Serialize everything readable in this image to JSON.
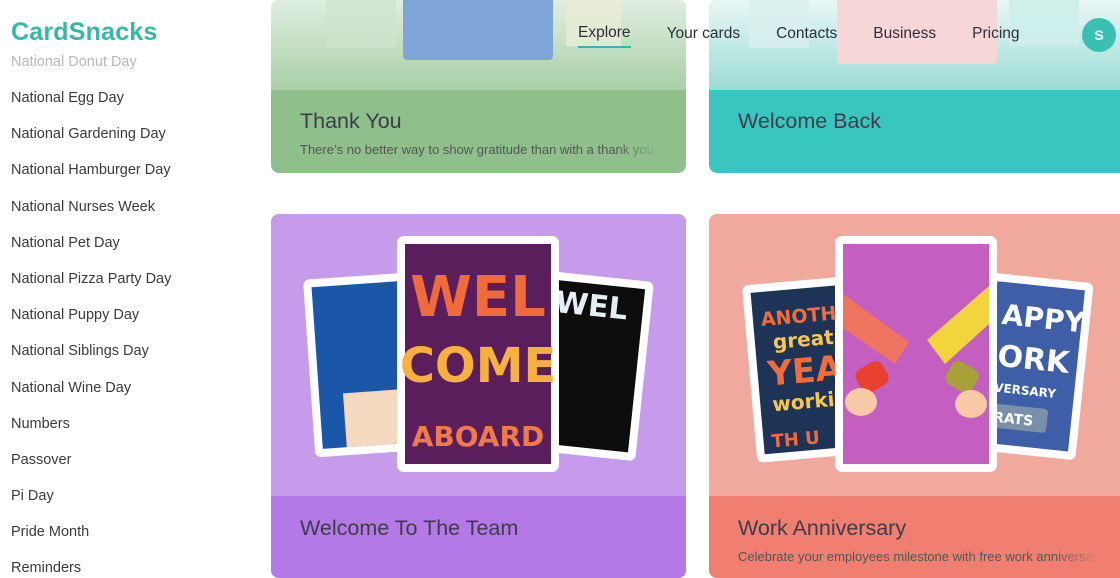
{
  "app": {
    "brand": "CardSnacks"
  },
  "nav": {
    "items": [
      {
        "label": "Explore",
        "active": true
      },
      {
        "label": "Your cards"
      },
      {
        "label": "Contacts"
      },
      {
        "label": "Business"
      },
      {
        "label": "Pricing"
      }
    ],
    "avatar_initial": "S"
  },
  "sidebar": {
    "items": [
      {
        "label": "National Donut Day"
      },
      {
        "label": "National Egg Day"
      },
      {
        "label": "National Gardening Day"
      },
      {
        "label": "National Hamburger Day"
      },
      {
        "label": "National Nurses Week"
      },
      {
        "label": "National Pet Day"
      },
      {
        "label": "National Pizza Party Day"
      },
      {
        "label": "National Puppy Day"
      },
      {
        "label": "National Siblings Day"
      },
      {
        "label": "National Wine Day"
      },
      {
        "label": "Numbers"
      },
      {
        "label": "Passover"
      },
      {
        "label": "Pi Day"
      },
      {
        "label": "Pride Month"
      },
      {
        "label": "Reminders"
      }
    ]
  },
  "cards": [
    {
      "title": "Thank You",
      "description": "There’s no better way to show gratitude than with a thank you card"
    },
    {
      "title": "Welcome Back",
      "description": ""
    },
    {
      "title": "Welcome To The Team",
      "description": "",
      "art_text": [
        "WEL",
        "COME",
        "ABOARD",
        "WEL"
      ]
    },
    {
      "title": "Work Anniversary",
      "description": "Celebrate your employees milestone with free work anniversary cards",
      "art_text": [
        "ANOTH",
        "great",
        "YEA",
        "worki",
        "TH U",
        "APPY",
        "ORK",
        "VERSARY",
        "RATS"
      ]
    }
  ],
  "colors": {
    "brand": "#35b9a5",
    "thank_you": "#8fc08c",
    "welcome_back": "#3ac6c0",
    "welcome_team": "#b479e6",
    "work_anniversary": "#f07f72"
  }
}
